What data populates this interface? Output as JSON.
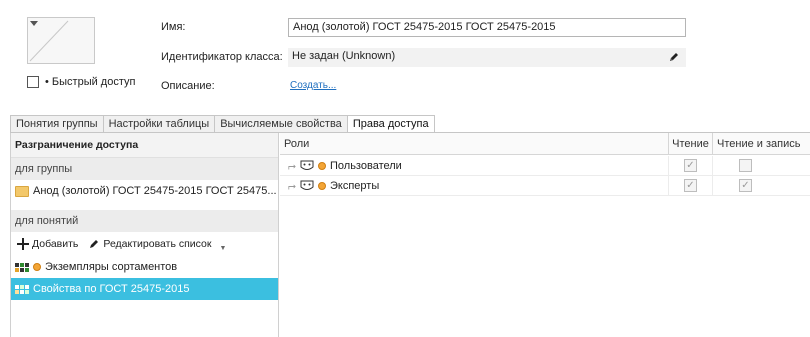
{
  "props": {
    "name_label": "Имя:",
    "name_value": "Анод (золотой) ГОСТ 25475-2015 ГОСТ 25475-2015",
    "classid_label": "Идентификатор класса:",
    "classid_value": "Не задан (Unknown)",
    "desc_label": "Описание:",
    "desc_link": "Создать...",
    "quick_access_label": "• Быстрый доступ"
  },
  "tabs": [
    {
      "label": "Понятия группы"
    },
    {
      "label": "Настройки таблицы"
    },
    {
      "label": "Вычисляемые свойства"
    },
    {
      "label": "Права доступа"
    }
  ],
  "left_panel": {
    "title": "Разграничение доступа",
    "group_section": "для группы",
    "group_item": "Анод (золотой) ГОСТ 25475-2015 ГОСТ 25475...",
    "concepts_section": "для понятий",
    "add_label": "Добавить",
    "edit_label": "Редактировать список",
    "items": [
      {
        "label": "Экземпляры сортаментов"
      },
      {
        "label": "Свойства по ГОСТ 25475-2015"
      }
    ]
  },
  "table": {
    "headers": {
      "roles": "Роли",
      "read": "Чтение",
      "rw": "Чтение и запись"
    },
    "rows": [
      {
        "role": "Пользователи",
        "read": true,
        "rw": false
      },
      {
        "role": "Эксперты",
        "read": true,
        "rw": true
      }
    ]
  },
  "colors": {
    "selection": "#3bbfe0",
    "link": "#1f6fbf"
  }
}
